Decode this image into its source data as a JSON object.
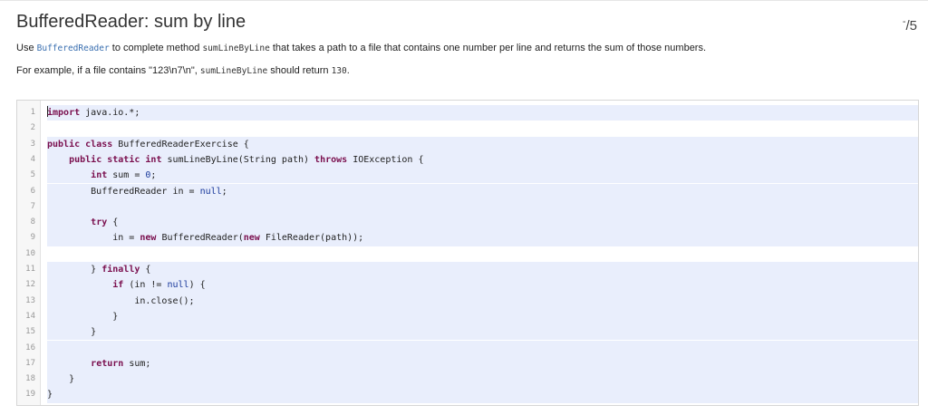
{
  "exercise": {
    "title": "BufferedReader: sum by line",
    "score": {
      "numerator": "-",
      "denominator": "5"
    },
    "description": {
      "p1_before": "Use ",
      "p1_code1": "BufferedReader",
      "p1_mid": " to complete method ",
      "p1_code2": "sumLineByLine",
      "p1_after": " that takes a path to a file that contains one number per line and returns the sum of those numbers.",
      "p2_before": "For example, if a file contains \"123\\n7\\n\", ",
      "p2_code1": "sumLineByLine",
      "p2_mid": " should return ",
      "p2_code2": "130",
      "p2_after": "."
    }
  },
  "editor": {
    "lines": [
      {
        "n": "1",
        "tokens": [
          {
            "t": "import",
            "c": "kw"
          },
          {
            "t": " java.io.*;",
            "c": ""
          }
        ]
      },
      {
        "n": "2",
        "tokens": [],
        "blank": true
      },
      {
        "n": "3",
        "tokens": [
          {
            "t": "public",
            "c": "kw"
          },
          {
            "t": " ",
            "c": ""
          },
          {
            "t": "class",
            "c": "kw"
          },
          {
            "t": " BufferedReaderExercise {",
            "c": ""
          }
        ]
      },
      {
        "n": "4",
        "tokens": [
          {
            "t": "    ",
            "c": ""
          },
          {
            "t": "public",
            "c": "kw"
          },
          {
            "t": " ",
            "c": ""
          },
          {
            "t": "static",
            "c": "kw"
          },
          {
            "t": " ",
            "c": ""
          },
          {
            "t": "int",
            "c": "kw"
          },
          {
            "t": " sumLineByLine(String path) ",
            "c": ""
          },
          {
            "t": "throws",
            "c": "kw"
          },
          {
            "t": " IOException {",
            "c": ""
          }
        ]
      },
      {
        "n": "5",
        "tokens": [
          {
            "t": "        ",
            "c": ""
          },
          {
            "t": "int",
            "c": "kw"
          },
          {
            "t": " sum = ",
            "c": ""
          },
          {
            "t": "0",
            "c": "lit"
          },
          {
            "t": ";",
            "c": ""
          }
        ]
      },
      {
        "n": "6",
        "tokens": [
          {
            "t": "        BufferedReader in = ",
            "c": ""
          },
          {
            "t": "null",
            "c": "lit"
          },
          {
            "t": ";",
            "c": ""
          }
        ]
      },
      {
        "n": "7",
        "tokens": []
      },
      {
        "n": "8",
        "tokens": [
          {
            "t": "        ",
            "c": ""
          },
          {
            "t": "try",
            "c": "kw"
          },
          {
            "t": " {",
            "c": ""
          }
        ]
      },
      {
        "n": "9",
        "tokens": [
          {
            "t": "            in = ",
            "c": ""
          },
          {
            "t": "new",
            "c": "kw"
          },
          {
            "t": " BufferedReader(",
            "c": ""
          },
          {
            "t": "new",
            "c": "kw"
          },
          {
            "t": " FileReader(path));",
            "c": ""
          }
        ]
      },
      {
        "n": "10",
        "tokens": [],
        "blank": true
      },
      {
        "n": "11",
        "tokens": [
          {
            "t": "        } ",
            "c": ""
          },
          {
            "t": "finally",
            "c": "kw"
          },
          {
            "t": " {",
            "c": ""
          }
        ]
      },
      {
        "n": "12",
        "tokens": [
          {
            "t": "            ",
            "c": ""
          },
          {
            "t": "if",
            "c": "kw"
          },
          {
            "t": " (in != ",
            "c": ""
          },
          {
            "t": "null",
            "c": "lit"
          },
          {
            "t": ") {",
            "c": ""
          }
        ]
      },
      {
        "n": "13",
        "tokens": [
          {
            "t": "                in.close();",
            "c": ""
          }
        ]
      },
      {
        "n": "14",
        "tokens": [
          {
            "t": "            }",
            "c": ""
          }
        ]
      },
      {
        "n": "15",
        "tokens": [
          {
            "t": "        }",
            "c": ""
          }
        ]
      },
      {
        "n": "16",
        "tokens": []
      },
      {
        "n": "17",
        "tokens": [
          {
            "t": "        ",
            "c": ""
          },
          {
            "t": "return",
            "c": "kw"
          },
          {
            "t": " sum;",
            "c": ""
          }
        ]
      },
      {
        "n": "18",
        "tokens": [
          {
            "t": "    }",
            "c": ""
          }
        ]
      },
      {
        "n": "19",
        "tokens": [
          {
            "t": "}",
            "c": ""
          }
        ]
      }
    ]
  }
}
